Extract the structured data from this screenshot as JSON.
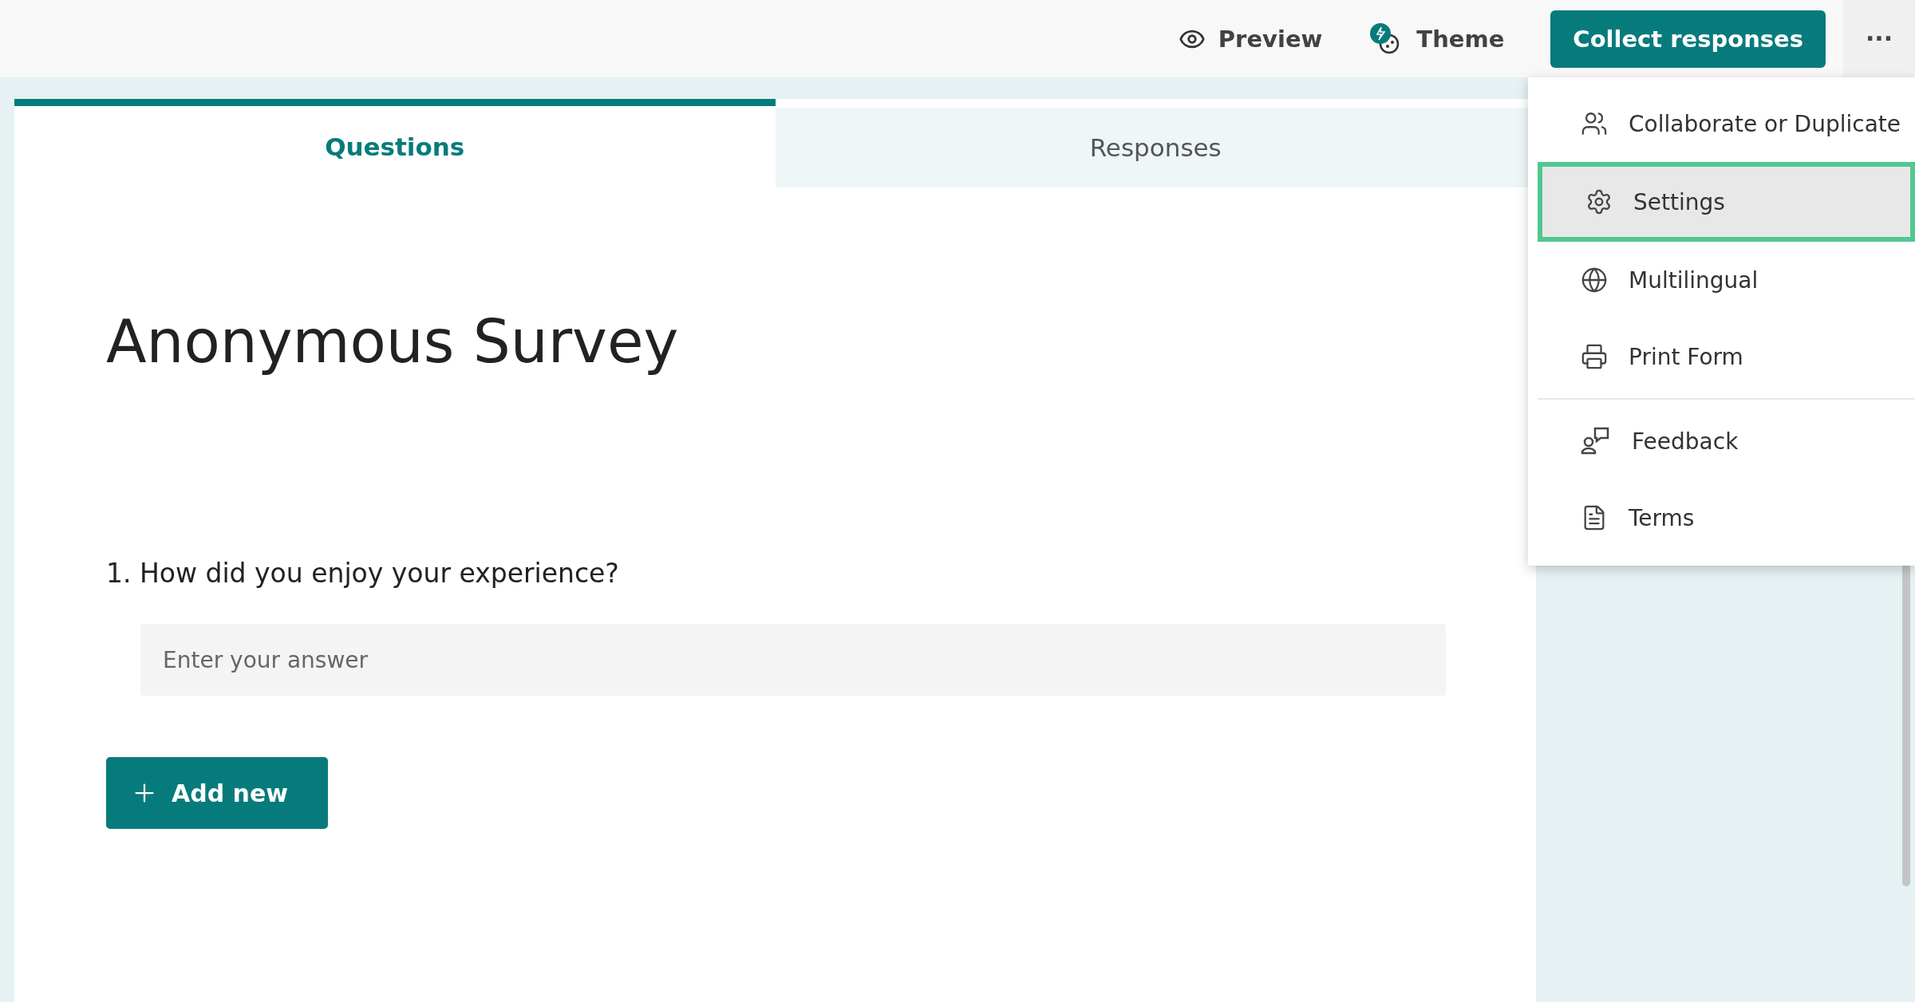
{
  "toolbar": {
    "preview": "Preview",
    "theme": "Theme",
    "collect": "Collect responses",
    "more": "···"
  },
  "tabs": [
    {
      "label": "Questions",
      "selected": true
    },
    {
      "label": "Responses",
      "selected": false
    }
  ],
  "form": {
    "title": "Anonymous Survey",
    "questions": [
      {
        "number": "1.",
        "text": "How did you enjoy your experience?",
        "placeholder": "Enter your answer"
      }
    ],
    "add_button": "Add new"
  },
  "menu": {
    "groups": [
      [
        {
          "label": "Collaborate or Duplicate",
          "kind": "people",
          "selected": false
        },
        {
          "label": "Settings",
          "kind": "gear",
          "selected": true
        },
        {
          "label": "Multilingual",
          "kind": "globe",
          "selected": false
        },
        {
          "label": "Print Form",
          "kind": "printer",
          "selected": false
        }
      ],
      [
        {
          "label": "Feedback",
          "kind": "feedback",
          "selected": false
        },
        {
          "label": "Terms",
          "kind": "document",
          "selected": false
        }
      ]
    ]
  }
}
